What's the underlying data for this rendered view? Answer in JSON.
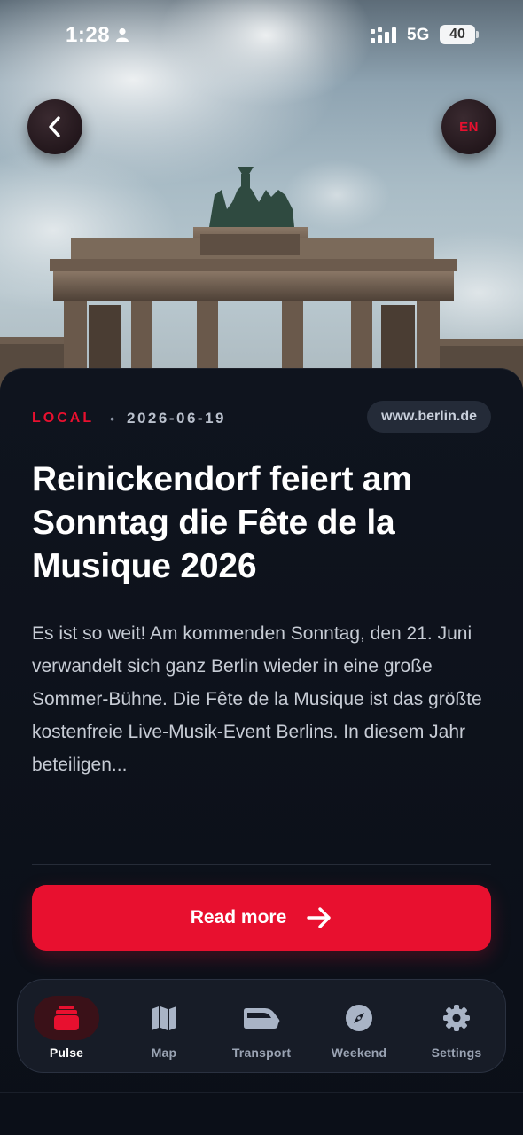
{
  "status_bar": {
    "time": "1:28",
    "network": "5G",
    "battery": "40"
  },
  "header": {
    "language": "EN"
  },
  "article": {
    "category": "LOCAL",
    "separator": "•",
    "date": "2026-06-19",
    "source": "www.berlin.de",
    "title": "Reinickendorf feiert am Sonntag die Fête de la Musique 2026",
    "excerpt": "Es ist so weit! Am kommenden Sonntag, den 21. Juni verwandelt sich ganz Berlin wieder in eine große Sommer-Bühne. Die Fête de la Musique ist das größte kostenfreie Live-Musik-Event Berlins. In diesem Jahr beteiligen..."
  },
  "actions": {
    "read_more": "Read more"
  },
  "tabs": [
    {
      "label": "Pulse",
      "icon": "pulse-icon",
      "active": true
    },
    {
      "label": "Map",
      "icon": "map-icon",
      "active": false
    },
    {
      "label": "Transport",
      "icon": "train-icon",
      "active": false
    },
    {
      "label": "Weekend",
      "icon": "compass-icon",
      "active": false
    },
    {
      "label": "Settings",
      "icon": "gear-icon",
      "active": false
    }
  ],
  "colors": {
    "accent": "#e8102f",
    "background": "#0b0f18",
    "surface": "#181d28"
  }
}
